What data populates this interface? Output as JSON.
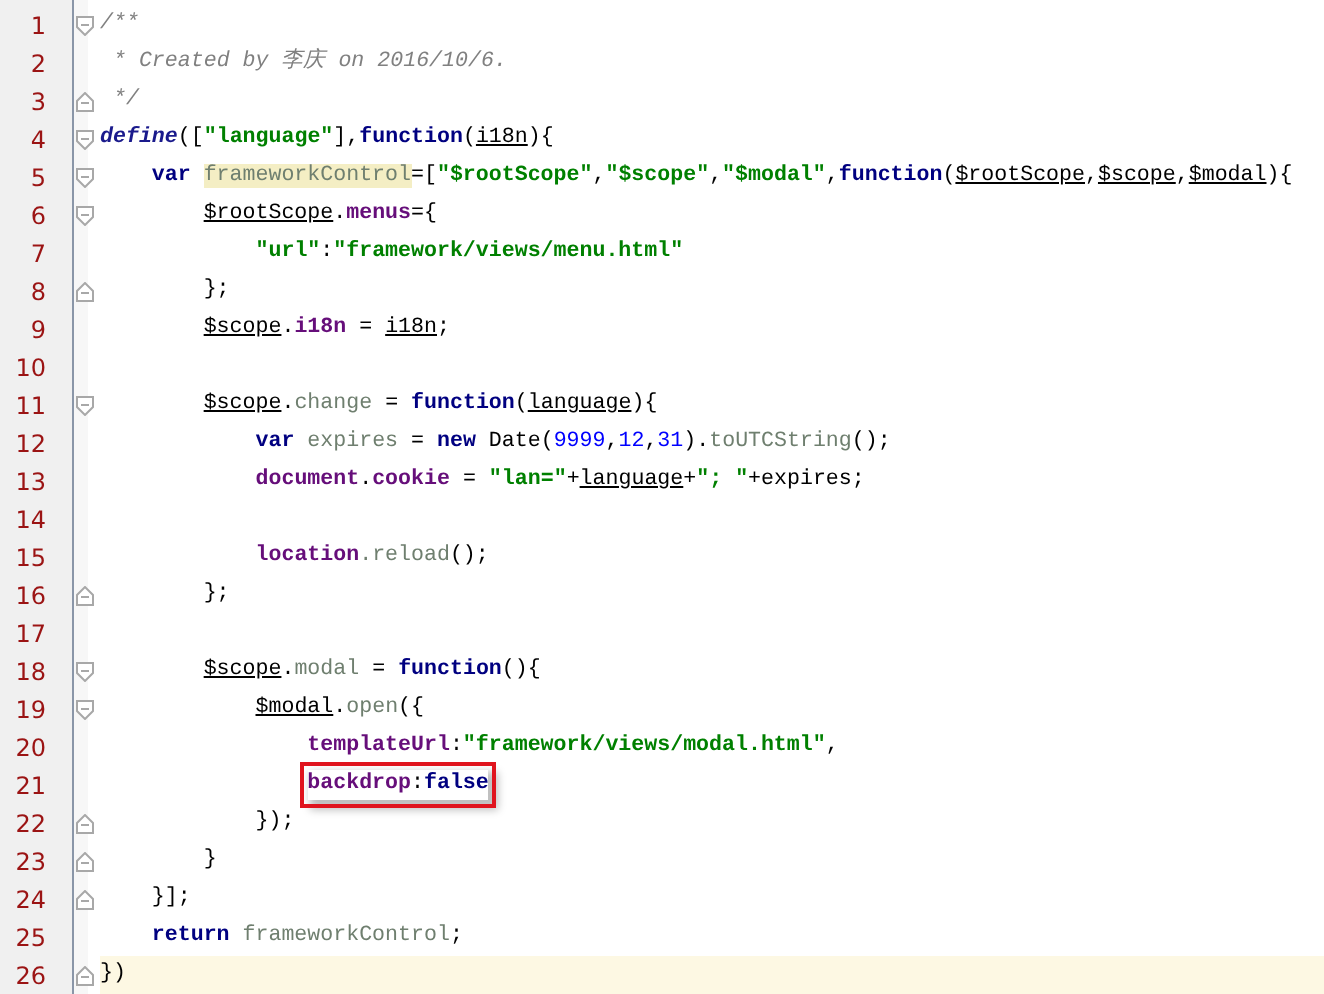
{
  "editor": {
    "lines": [
      {
        "number": "1",
        "fold_open": true,
        "fold_close": false,
        "tokens": [
          {
            "kind": "comment",
            "text": "/**"
          }
        ]
      },
      {
        "number": "2",
        "fold_open": false,
        "fold_close": false,
        "tokens": [
          {
            "kind": "comment",
            "text": " * Created by 李庆 on 2016/10/6."
          }
        ]
      },
      {
        "number": "3",
        "fold_open": false,
        "fold_close": true,
        "tokens": [
          {
            "kind": "comment",
            "text": " */"
          }
        ]
      },
      {
        "number": "4",
        "fold_open": true,
        "fold_close": false,
        "tokens": [
          {
            "kind": "define",
            "text": "define"
          },
          {
            "kind": "plain",
            "text": "(["
          },
          {
            "kind": "string",
            "text": "\"language\""
          },
          {
            "kind": "plain",
            "text": "],"
          },
          {
            "kind": "keyword",
            "text": "function"
          },
          {
            "kind": "plain",
            "text": "("
          },
          {
            "kind": "param",
            "text": "i18n"
          },
          {
            "kind": "plain",
            "text": "){"
          }
        ],
        "children": [
          {
            "number": "5",
            "fold_open": true,
            "fold_close": false,
            "tokens": [
              {
                "kind": "keyword",
                "text": "var "
              },
              {
                "kind": "local",
                "text": "frameworkControl",
                "highlighted": true
              },
              {
                "kind": "plain",
                "text": "=["
              },
              {
                "kind": "string",
                "text": "\"$rootScope\""
              },
              {
                "kind": "plain",
                "text": ","
              },
              {
                "kind": "string",
                "text": "\"$scope\""
              },
              {
                "kind": "plain",
                "text": ","
              },
              {
                "kind": "string",
                "text": "\"$modal\""
              },
              {
                "kind": "plain",
                "text": ","
              },
              {
                "kind": "keyword",
                "text": "function"
              },
              {
                "kind": "plain",
                "text": "("
              },
              {
                "kind": "param",
                "text": "$rootScope"
              },
              {
                "kind": "plain",
                "text": ","
              },
              {
                "kind": "param",
                "text": "$scope"
              },
              {
                "kind": "plain",
                "text": ","
              },
              {
                "kind": "param",
                "text": "$modal"
              },
              {
                "kind": "plain",
                "text": "){"
              }
            ],
            "children": [
              {
                "number": "6",
                "fold_open": true,
                "fold_close": false,
                "tokens": [
                  {
                    "kind": "param",
                    "text": "$rootScope"
                  },
                  {
                    "kind": "plain",
                    "text": "."
                  },
                  {
                    "kind": "field",
                    "text": "menus"
                  },
                  {
                    "kind": "plain",
                    "text": "={"
                  }
                ],
                "children": [
                  {
                    "number": "7",
                    "fold_open": false,
                    "fold_close": false,
                    "tokens": [
                      {
                        "kind": "string",
                        "text": "\"url\""
                      },
                      {
                        "kind": "plain",
                        "text": ":"
                      },
                      {
                        "kind": "string",
                        "text": "\"framework/views/menu.html\""
                      }
                    ]
                  }
                ]
              },
              {
                "number": "8",
                "fold_open": false,
                "fold_close": true,
                "tokens": [
                  {
                    "kind": "plain",
                    "text": "};"
                  }
                ]
              },
              {
                "number": "9",
                "fold_open": false,
                "fold_close": false,
                "tokens": [
                  {
                    "kind": "param",
                    "text": "$scope"
                  },
                  {
                    "kind": "plain",
                    "text": "."
                  },
                  {
                    "kind": "field",
                    "text": "i18n"
                  },
                  {
                    "kind": "plain",
                    "text": " = "
                  },
                  {
                    "kind": "param",
                    "text": "i18n"
                  },
                  {
                    "kind": "plain",
                    "text": ";"
                  }
                ]
              },
              {
                "number": "10",
                "fold_open": false,
                "fold_close": false
              },
              {
                "number": "11",
                "fold_open": true,
                "fold_close": false,
                "tokens": [
                  {
                    "kind": "param",
                    "text": "$scope"
                  },
                  {
                    "kind": "plain",
                    "text": "."
                  },
                  {
                    "kind": "local",
                    "text": "change"
                  },
                  {
                    "kind": "plain",
                    "text": " = "
                  },
                  {
                    "kind": "keyword",
                    "text": "function"
                  },
                  {
                    "kind": "plain",
                    "text": "("
                  },
                  {
                    "kind": "param",
                    "text": "language"
                  },
                  {
                    "kind": "plain",
                    "text": "){"
                  }
                ],
                "children": [
                  {
                    "number": "12",
                    "fold_open": false,
                    "fold_close": false,
                    "tokens": [
                      {
                        "kind": "keyword",
                        "text": "var "
                      },
                      {
                        "kind": "local",
                        "text": "expires"
                      },
                      {
                        "kind": "plain",
                        "text": " = "
                      },
                      {
                        "kind": "keyword",
                        "text": "new "
                      },
                      {
                        "kind": "plain",
                        "text": "Date("
                      },
                      {
                        "kind": "number",
                        "text": "9999"
                      },
                      {
                        "kind": "plain",
                        "text": ","
                      },
                      {
                        "kind": "number",
                        "text": "12"
                      },
                      {
                        "kind": "plain",
                        "text": ","
                      },
                      {
                        "kind": "number",
                        "text": "31"
                      },
                      {
                        "kind": "plain",
                        "text": ")."
                      },
                      {
                        "kind": "local",
                        "text": "toUTCString"
                      },
                      {
                        "kind": "plain",
                        "text": "();"
                      }
                    ]
                  },
                  {
                    "number": "13",
                    "fold_open": false,
                    "fold_close": false,
                    "tokens": [
                      {
                        "kind": "field",
                        "text": "document"
                      },
                      {
                        "kind": "plain",
                        "text": "."
                      },
                      {
                        "kind": "field",
                        "text": "cookie"
                      },
                      {
                        "kind": "plain",
                        "text": " = "
                      },
                      {
                        "kind": "string",
                        "text": "\"lan=\""
                      },
                      {
                        "kind": "plain",
                        "text": "+"
                      },
                      {
                        "kind": "param",
                        "text": "language"
                      },
                      {
                        "kind": "plain",
                        "text": "+"
                      },
                      {
                        "kind": "string",
                        "text": "\"; \""
                      },
                      {
                        "kind": "plain",
                        "text": "+expires;"
                      }
                    ]
                  },
                  {
                    "number": "14",
                    "fold_open": false,
                    "fold_close": false
                  },
                  {
                    "number": "15",
                    "fold_open": false,
                    "fold_close": false,
                    "tokens": [
                      {
                        "kind": "field",
                        "text": "location"
                      },
                      {
                        "kind": "local",
                        "text": ".reload"
                      },
                      {
                        "kind": "plain",
                        "text": "();"
                      }
                    ]
                  }
                ]
              },
              {
                "number": "16",
                "fold_open": false,
                "fold_close": true,
                "tokens": [
                  {
                    "kind": "plain",
                    "text": "};"
                  }
                ]
              },
              {
                "number": "17",
                "fold_open": false,
                "fold_close": false
              },
              {
                "number": "18",
                "fold_open": true,
                "fold_close": false,
                "tokens": [
                  {
                    "kind": "param",
                    "text": "$scope"
                  },
                  {
                    "kind": "plain",
                    "text": "."
                  },
                  {
                    "kind": "local",
                    "text": "modal"
                  },
                  {
                    "kind": "plain",
                    "text": " = "
                  },
                  {
                    "kind": "keyword",
                    "text": "function"
                  },
                  {
                    "kind": "plain",
                    "text": "(){"
                  }
                ],
                "children": [
                  {
                    "number": "19",
                    "fold_open": true,
                    "fold_close": false,
                    "tokens": [
                      {
                        "kind": "param",
                        "text": "$modal"
                      },
                      {
                        "kind": "plain",
                        "text": "."
                      },
                      {
                        "kind": "local",
                        "text": "open"
                      },
                      {
                        "kind": "plain",
                        "text": "({"
                      }
                    ],
                    "children": [
                      {
                        "number": "20",
                        "fold_open": false,
                        "fold_close": false,
                        "tokens": [
                          {
                            "kind": "field",
                            "text": "templateUrl"
                          },
                          {
                            "kind": "plain",
                            "text": ":"
                          },
                          {
                            "kind": "string",
                            "text": "\"framework/views/modal.html\""
                          },
                          {
                            "kind": "plain",
                            "text": ","
                          }
                        ]
                      },
                      {
                        "number": "21",
                        "fold_open": false,
                        "fold_close": false,
                        "boxed": true,
                        "tokens": [
                          {
                            "kind": "field",
                            "text": "backdrop"
                          },
                          {
                            "kind": "plain",
                            "text": ":"
                          },
                          {
                            "kind": "keyword",
                            "text": "false"
                          }
                        ]
                      }
                    ]
                  },
                  {
                    "number": "22",
                    "fold_open": false,
                    "fold_close": true,
                    "tokens": [
                      {
                        "kind": "plain",
                        "text": "});"
                      }
                    ]
                  }
                ]
              },
              {
                "number": "23",
                "fold_open": false,
                "fold_close": true,
                "tokens": [
                  {
                    "kind": "plain",
                    "text": "}"
                  }
                ]
              }
            ]
          },
          {
            "number": "24",
            "fold_open": false,
            "fold_close": true,
            "tokens": [
              {
                "kind": "plain",
                "text": "}];"
              }
            ]
          },
          {
            "number": "25",
            "fold_open": false,
            "fold_close": false,
            "tokens": [
              {
                "kind": "keyword",
                "text": "return "
              },
              {
                "kind": "local",
                "text": "frameworkControl"
              },
              {
                "kind": "plain",
                "text": ";"
              }
            ]
          }
        ]
      },
      {
        "number": "26",
        "fold_open": false,
        "fold_close": true,
        "current": true,
        "tokens": [
          {
            "kind": "plain",
            "text": "})"
          }
        ]
      }
    ]
  }
}
